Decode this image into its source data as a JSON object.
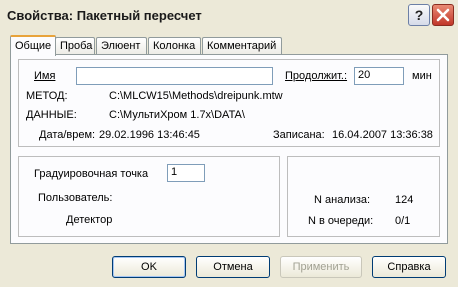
{
  "window": {
    "title": "Свойства: Пакетный пересчет"
  },
  "titlebar": {
    "help_label": "?"
  },
  "tabs": [
    {
      "label": "Общие",
      "active": true
    },
    {
      "label": "Проба",
      "active": false
    },
    {
      "label": "Элюент",
      "active": false
    },
    {
      "label": "Колонка",
      "active": false
    },
    {
      "label": "Комментарий",
      "active": false
    }
  ],
  "general": {
    "name_label": "Имя",
    "name_value": "",
    "duration_label": "Продолжит.:",
    "duration_value": "20",
    "duration_unit": "мин",
    "method_label": "МЕТОД:",
    "method_value": "C:\\MLCW15\\Methods\\dreipunk.mtw",
    "data_label": "ДАННЫЕ:",
    "data_value": "C:\\МультиХром 1.7x\\DATA\\",
    "datetime_label": "Дата/врем:",
    "datetime_value": "29.02.1996 13:46:45",
    "recorded_label": "Записана:",
    "recorded_value": "16.04.2007 13:36:38"
  },
  "calibration": {
    "point_label": "Градуировочная точка",
    "point_value": "1",
    "user_label": "Пользователь:",
    "detector_label": "Детектор"
  },
  "stats": {
    "analysis_label": "N анализа:",
    "analysis_value": "124",
    "queue_label": "N в очереди:",
    "queue_value": "0/1"
  },
  "buttons": {
    "ok": "OK",
    "cancel": "Отмена",
    "apply": "Применить",
    "help": "Справка"
  }
}
